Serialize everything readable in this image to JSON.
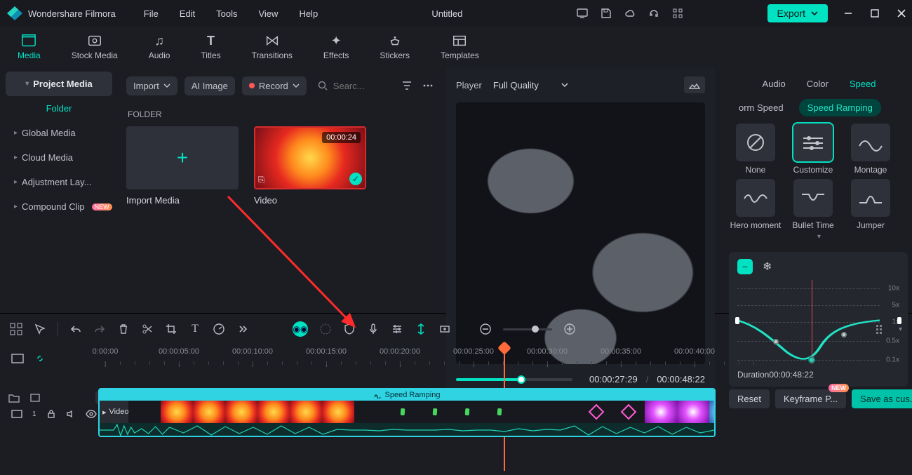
{
  "app_name": "Wondershare Filmora",
  "document_title": "Untitled",
  "menu": [
    "File",
    "Edit",
    "Tools",
    "View",
    "Help"
  ],
  "export_label": "Export",
  "main_tabs": [
    "Media",
    "Stock Media",
    "Audio",
    "Titles",
    "Transitions",
    "Effects",
    "Stickers",
    "Templates"
  ],
  "sidebar": {
    "header": "Project Media",
    "folder": "Folder",
    "items": [
      "Global Media",
      "Cloud Media",
      "Adjustment Lay...",
      "Compound Clip"
    ]
  },
  "media_toolbar": {
    "import": "Import",
    "ai_image": "AI Image",
    "record": "Record",
    "search_placeholder": "Searc..."
  },
  "folder_heading": "FOLDER",
  "thumbs": {
    "import_tile": "Import Media",
    "video_tile": "Video",
    "video_duration": "00:00:24"
  },
  "player": {
    "label": "Player",
    "quality": "Full Quality",
    "current": "00:00:27:29",
    "total": "00:00:48:22"
  },
  "inspector": {
    "tabs": [
      "Audio",
      "Color",
      "Speed"
    ],
    "sub_left": "orm Speed",
    "sub_right": "Speed Ramping",
    "presets": [
      "None",
      "Customize",
      "Montage",
      "Hero moment",
      "Bullet Time",
      "Jumper"
    ],
    "duration_label": "Duration",
    "duration_value": "00:00:48:22",
    "speed_labels": [
      "10x",
      "5x",
      "1x",
      "0.5x",
      "0.1x"
    ],
    "buttons": {
      "reset": "Reset",
      "keyframe": "Keyframe P...",
      "save": "Save as cus..."
    }
  },
  "timeline": {
    "marks": [
      "0:00:00",
      "00:00:05:00",
      "00:00:10:00",
      "00:00:15:00",
      "00:00:20:00",
      "00:00:25:00",
      "00:00:30:00",
      "00:00:35:00",
      "00:00:40:00"
    ],
    "track_header": "Speed Ramping",
    "clip_label": "Video",
    "row_index": "1"
  },
  "badges": {
    "new": "NEW"
  }
}
